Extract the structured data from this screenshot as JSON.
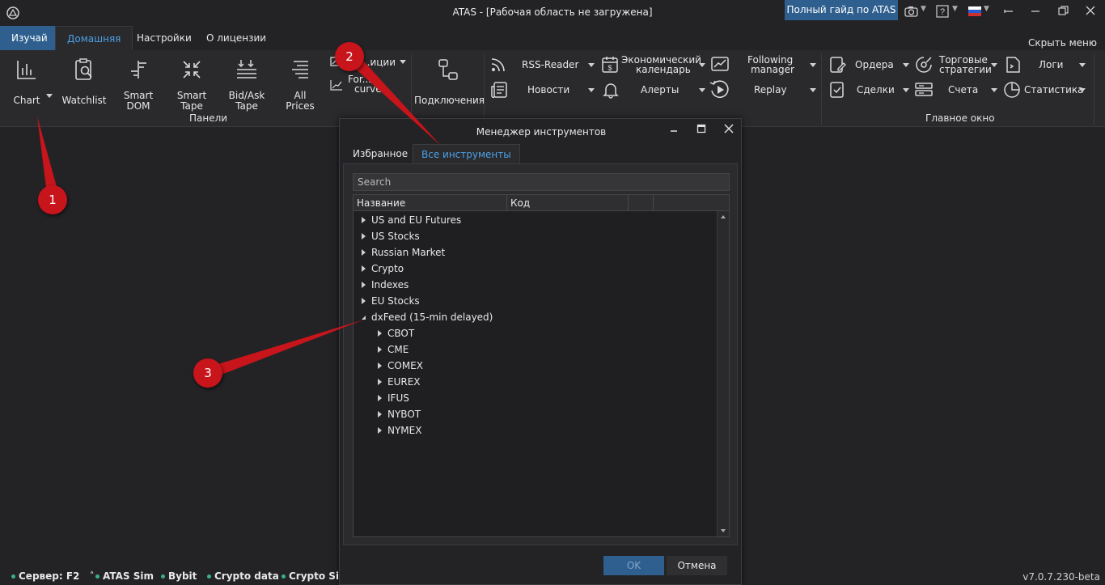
{
  "window": {
    "title": "ATAS - [Рабочая область не загружена]",
    "guide_button": "Полный гайд по ATAS",
    "icons": [
      "app-logo",
      "camera-icon",
      "help-icon",
      "language-flag-icon",
      "minimize-icon",
      "restore-icon",
      "close-icon"
    ]
  },
  "ribbon_tabs": {
    "learn": "Изучай",
    "home": "Домашняя",
    "settings": "Настройки",
    "license": "О лицензии",
    "hide_menu": "Скрыть меню"
  },
  "ribbon": {
    "panels_group": {
      "label": "Панели",
      "chart": "Chart",
      "watchlist": "Watchlist",
      "smart_dom_1": "Smart",
      "smart_dom_2": "DOM",
      "smart_tape_1": "Smart",
      "smart_tape_2": "Tape",
      "bidask_1": "Bid/Ask",
      "bidask_2": "Tape",
      "allprices_1": "All",
      "allprices_2": "Prices",
      "positions": "...иции",
      "forward_1": "For...",
      "forward_2": "curve"
    },
    "connections": "Подключения",
    "tools": {
      "rss": "RSS-Reader",
      "news": "Новости",
      "econ_1": "Экономический",
      "econ_2": "календарь",
      "alerts": "Алерты",
      "following_1": "Following",
      "following_2": "manager",
      "replay": "Replay"
    },
    "main_window": {
      "label": "Главное окно",
      "orders": "Ордера",
      "deals": "Сделки",
      "strategies_1": "Торговые",
      "strategies_2": "стратегии",
      "accounts": "Счета",
      "logs": "Логи",
      "statistics": "Статистика"
    }
  },
  "dialog": {
    "title": "Менеджер инструментов",
    "tab_favorites": "Избранное",
    "tab_all": "Все инструменты",
    "search_placeholder": "Search",
    "columns": [
      "Название",
      "Код",
      "",
      ""
    ],
    "tree": [
      {
        "label": "US and EU Futures",
        "expanded": false,
        "level": 0
      },
      {
        "label": "US Stocks",
        "expanded": false,
        "level": 0
      },
      {
        "label": "Russian Market",
        "expanded": false,
        "level": 0
      },
      {
        "label": "Crypto",
        "expanded": false,
        "level": 0
      },
      {
        "label": "Indexes",
        "expanded": false,
        "level": 0
      },
      {
        "label": "EU Stocks",
        "expanded": false,
        "level": 0
      },
      {
        "label": "dxFeed (15-min delayed)",
        "expanded": true,
        "level": 0
      },
      {
        "label": "CBOT",
        "expanded": false,
        "level": 1
      },
      {
        "label": "CME",
        "expanded": false,
        "level": 1
      },
      {
        "label": "COMEX",
        "expanded": false,
        "level": 1
      },
      {
        "label": "EUREX",
        "expanded": false,
        "level": 1
      },
      {
        "label": "IFUS",
        "expanded": false,
        "level": 1
      },
      {
        "label": "NYBOT",
        "expanded": false,
        "level": 1
      },
      {
        "label": "NYMEX",
        "expanded": false,
        "level": 1
      }
    ],
    "ok": "OK",
    "cancel": "Отмена"
  },
  "status_bar": {
    "server": "Сервер: F2",
    "items": [
      "ATAS Sim",
      "Bybit",
      "Crypto data",
      "Crypto Sim"
    ],
    "version": "v7.0.7.230-beta"
  },
  "annotations": [
    "1",
    "2",
    "3"
  ],
  "colors": {
    "accent": "#2f5f8f",
    "active_tab_text": "#4aa0e6",
    "annotation": "#c8141b",
    "status_dot": "#3ab08a"
  }
}
